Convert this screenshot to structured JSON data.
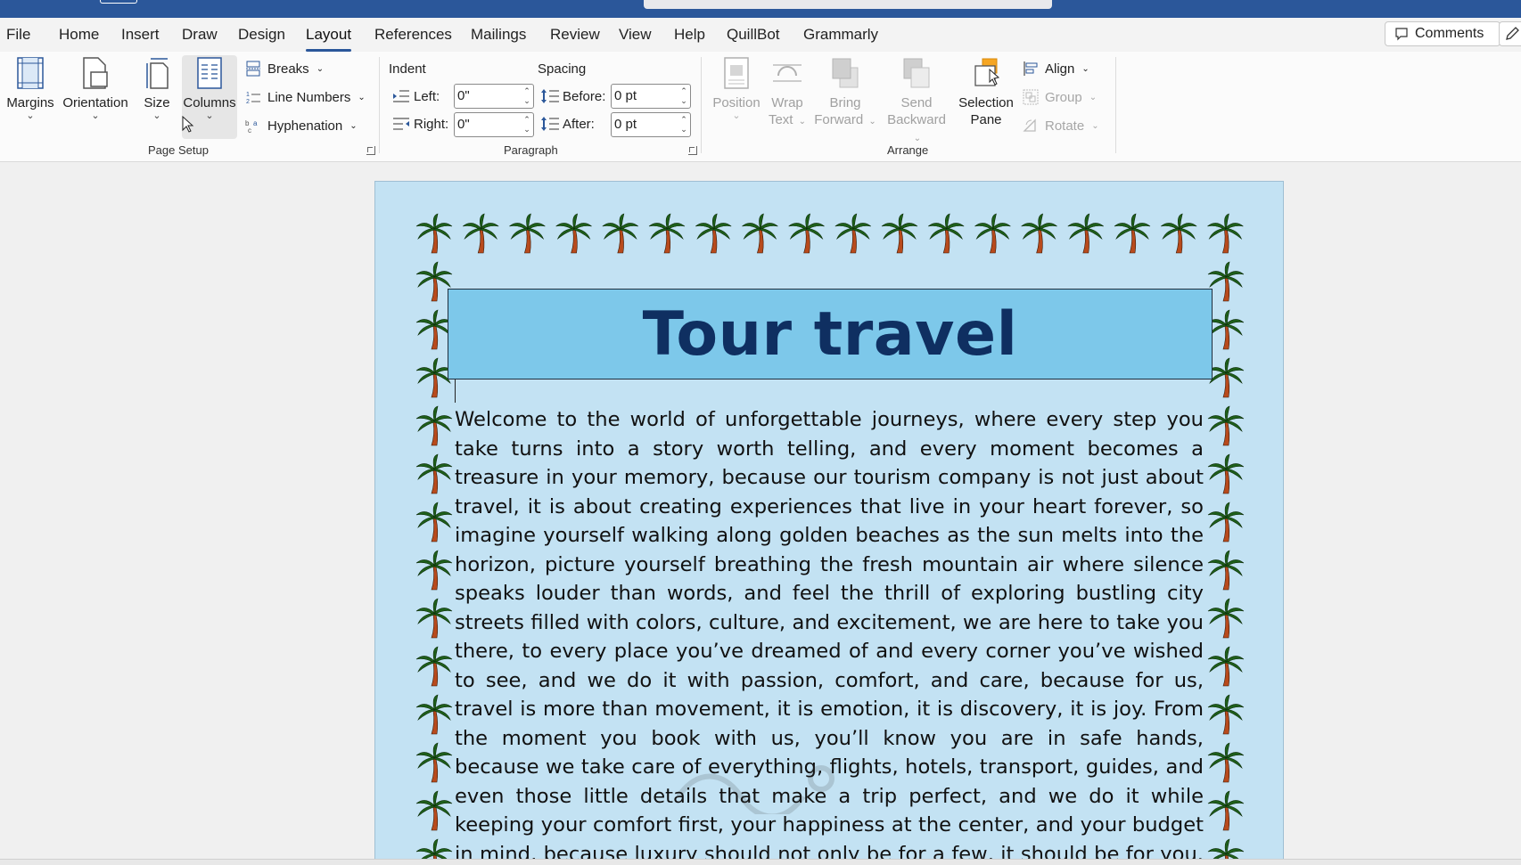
{
  "tabs": [
    "File",
    "Home",
    "Insert",
    "Draw",
    "Design",
    "Layout",
    "References",
    "Mailings",
    "Review",
    "View",
    "Help",
    "QuillBot",
    "Grammarly"
  ],
  "active_tab": "Layout",
  "comments_label": "Comments",
  "page_setup": {
    "margins": "Margins",
    "orientation": "Orientation",
    "size": "Size",
    "columns": "Columns",
    "breaks": "Breaks",
    "line_numbers": "Line Numbers",
    "hyphenation": "Hyphenation",
    "group_label": "Page Setup"
  },
  "paragraph": {
    "indent_label": "Indent",
    "spacing_label": "Spacing",
    "left_label": "Left:",
    "left_value": "0\"",
    "right_label": "Right:",
    "right_value": "0\"",
    "before_label": "Before:",
    "before_value": "0 pt",
    "after_label": "After:",
    "after_value": "0 pt",
    "group_label": "Paragraph"
  },
  "arrange": {
    "position": "Position",
    "wrap_line1": "Wrap",
    "wrap_line2": "Text",
    "bring_line1": "Bring",
    "bring_line2": "Forward",
    "send_line1": "Send",
    "send_line2": "Backward",
    "selection_line1": "Selection",
    "selection_line2": "Pane",
    "align": "Align",
    "group": "Group",
    "rotate": "Rotate",
    "group_label": "Arrange"
  },
  "document": {
    "title": "Tour travel",
    "body": "Welcome to the world of unforgettable journeys, where every step you take turns into a story worth telling, and every moment becomes a treasure in your memory, because our tourism company is not just about travel, it is about creating experiences that live in your heart forever, so imagine yourself walking along golden beaches as the sun melts into the horizon, picture yourself breathing the fresh mountain air where silence speaks louder than words, and feel the thrill of exploring bustling city streets filled with colors, culture, and excitement, we are here to take you there, to every place you’ve dreamed of and every corner you’ve wished to see, and we do it with passion, comfort, and care, because for us, travel is more than movement, it is emotion, it is discovery, it is joy. From the moment you book with us, you’ll know you are in safe hands, because we take care of everything, flights, hotels, transport, guides, and even those little details that make a trip perfect, and we do it while keeping your comfort first, your happiness at the center, and your budget in mind, because luxury should not only be for a few, it should be for you. Whether you dream of islands"
  },
  "colors": {
    "title_bar": "#2b579a",
    "page_background": "#c3e2f3",
    "title_box_fill": "#7dc8ea",
    "title_text": "#0f2f61"
  }
}
